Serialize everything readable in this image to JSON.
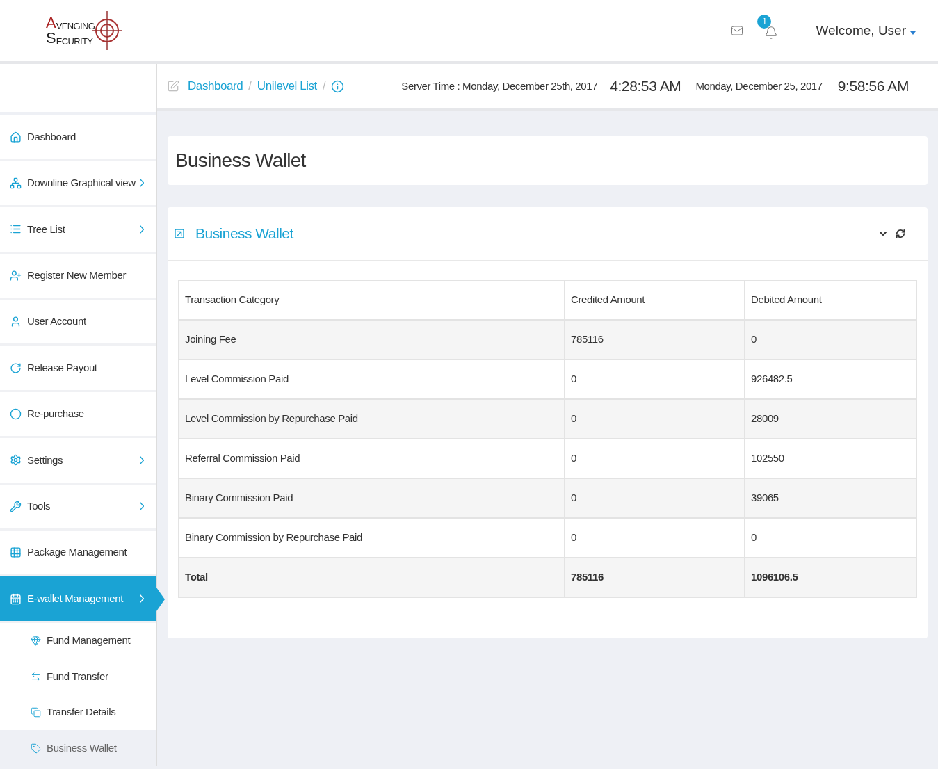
{
  "logo": {
    "line_1": "VENGING",
    "line_2": "ECURITY",
    "initial_1": "A",
    "initial_2": "S"
  },
  "header": {
    "notification_count": "1",
    "welcome": "Welcome, User"
  },
  "breadcrumb": [
    {
      "label": "Dashboard",
      "separator": "/"
    },
    {
      "label": "Unilevel List",
      "separator": "/"
    }
  ],
  "clock": {
    "server_time": "Server Time : Monday, December 25th, 2017",
    "server_clock": "4:28:53 AM",
    "local_date": "Monday, December 25, 2017",
    "local_clock": "9:58:56 AM"
  },
  "sidebar": {
    "items": [
      {
        "label": "Dashboard",
        "has_submenu": false,
        "selected": false
      },
      {
        "label": "Downline Graphical view",
        "has_submenu": true,
        "selected": false
      },
      {
        "label": "Tree List",
        "has_submenu": true,
        "selected": false
      },
      {
        "label": "Register New Member",
        "has_submenu": false,
        "selected": false
      },
      {
        "label": "User Account",
        "has_submenu": false,
        "selected": false
      },
      {
        "label": "Release Payout",
        "has_submenu": false,
        "selected": false
      },
      {
        "label": "Re-purchase",
        "has_submenu": false,
        "selected": false
      },
      {
        "label": "Settings",
        "has_submenu": true,
        "selected": false
      },
      {
        "label": "Tools",
        "has_submenu": true,
        "selected": false
      },
      {
        "label": "Package Management",
        "has_submenu": false,
        "selected": false
      },
      {
        "label": "E-wallet Management",
        "has_submenu": true,
        "selected": true,
        "children": [
          {
            "label": "Fund Management",
            "selected": false
          },
          {
            "label": "Fund Transfer",
            "selected": false
          },
          {
            "label": "Transfer Details",
            "selected": false
          },
          {
            "label": "Business Wallet",
            "selected": true
          }
        ]
      }
    ]
  },
  "page_title": "Business Wallet",
  "panel": {
    "title": "Business Wallet",
    "table": {
      "columns": [
        "Transaction Category",
        "Credited Amount",
        "Debited Amount"
      ],
      "rows": [
        {
          "kind": "data",
          "cells": [
            "Joining Fee",
            "785116",
            "0"
          ]
        },
        {
          "kind": "data",
          "cells": [
            "Level Commission Paid",
            "0",
            "926482.5"
          ]
        },
        {
          "kind": "data",
          "cells": [
            "Level Commission by Repurchase Paid",
            "0",
            "28009"
          ]
        },
        {
          "kind": "data",
          "cells": [
            "Referral Commission Paid",
            "0",
            "102550"
          ]
        },
        {
          "kind": "data",
          "cells": [
            "Binary Commission Paid",
            "0",
            "39065"
          ]
        },
        {
          "kind": "data",
          "cells": [
            "Binary Commission by Repurchase Paid",
            "0",
            "0"
          ]
        },
        {
          "kind": "total",
          "cells": [
            "Total",
            "785116",
            "1096106.5"
          ]
        }
      ]
    }
  }
}
